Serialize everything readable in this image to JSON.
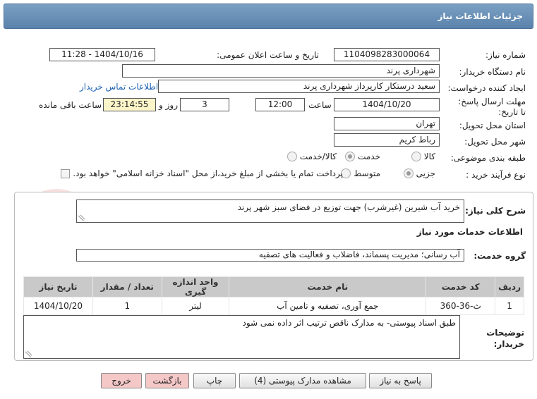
{
  "header": {
    "title": "جزئیات اطلاعات نیاز"
  },
  "form": {
    "need_number_label": "شماره نیاز:",
    "need_number": "1104098283000064",
    "announce_label": "تاریخ و ساعت اعلان عمومی:",
    "announce_value": "1404/10/16 - 11:28",
    "buyer_org_label": "نام دستگاه خریدار:",
    "buyer_org": "شهرداری پرند",
    "creator_label": "ایجاد کننده درخواست:",
    "creator": "سعید درستکار کارپرداز شهرداری پرند",
    "contact_link": "اطلاعات تماس خریدار",
    "deadline_label": "مهلت ارسال پاسخ: تا تاریخ:",
    "deadline_date": "1404/10/20",
    "time_label": "ساعت",
    "deadline_time": "12:00",
    "days_value": "3",
    "days_label": "روز و",
    "remaining_time": "23:14:55",
    "remaining_label": "ساعت باقی مانده",
    "province_label": "استان محل تحویل:",
    "province": "تهران",
    "city_label": "شهر محل تحویل:",
    "city": "رباط کریم",
    "category_label": "طبقه بندی موضوعی:",
    "category_options": [
      "کالا",
      "خدمت",
      "کالا/خدمت"
    ],
    "category_selected": "خدمت",
    "process_label": "نوع فرآیند خرید :",
    "process_options": [
      "جزیی",
      "متوسط"
    ],
    "process_selected": "جزیی",
    "treasury_note": "پرداخت تمام یا بخشی از مبلغ خرید،از محل \"اسناد خزانه اسلامی\" خواهد بود."
  },
  "details": {
    "summary_label": "شرح کلی نیاز:",
    "summary": "خرید آب شیرین (غیرشرب) جهت توزیع در فضای سبز شهر پرند",
    "services_heading": "اطلاعات خدمات مورد نیاز",
    "service_group_label": "گروه خدمت:",
    "service_group": "آب رسانی؛ مدیریت پسماند، فاضلاب و فعالیت های تصفیه"
  },
  "table": {
    "headers": [
      "ردیف",
      "کد خدمت",
      "نام خدمت",
      "واحد اندازه گیری",
      "تعداد / مقدار",
      "تاریخ نیاز"
    ],
    "rows": [
      [
        "1",
        "ث-36-360",
        "جمع آوری، تصفیه و تامین آب",
        "لیتر",
        "1",
        "1404/10/20"
      ]
    ]
  },
  "notes": {
    "label": "توضیحات خریدار:",
    "text": "طبق اسناد پیوستی- به مدارک ناقص ترتیب اثر داده نمی شود"
  },
  "buttons": {
    "reply": "پاسخ به نیاز",
    "attachments": "مشاهده مدارک پیوستی (4)",
    "print": "چاپ",
    "back": "بازگشت",
    "exit": "خروج"
  },
  "watermark": {
    "text": "AriaTender.neT"
  },
  "colors": {
    "title_bar": "#5b82ab",
    "link": "#1a5fb4",
    "yellow_field": "#fbf5c9",
    "pink_button": "#f5c8c8"
  }
}
